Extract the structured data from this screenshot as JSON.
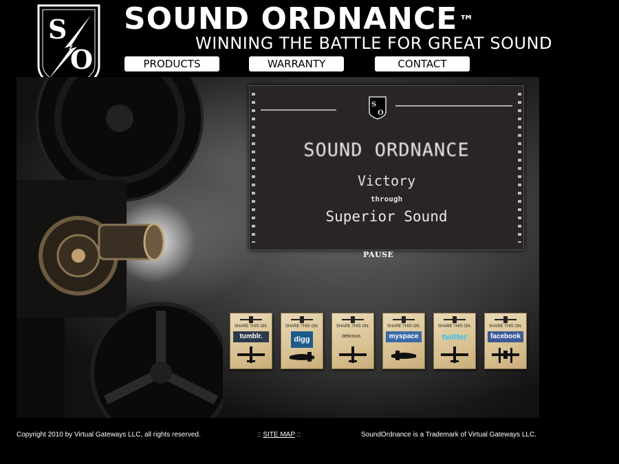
{
  "header": {
    "brand": "SOUND ORDNANCE",
    "trademark": "™",
    "tagline": "WINNING THE BATTLE FOR GREAT SOUND",
    "logo_text": "S/O"
  },
  "nav": [
    {
      "label": "PRODUCTS"
    },
    {
      "label": "WARRANTY"
    },
    {
      "label": "CONTACT"
    }
  ],
  "screen": {
    "title": "SOUND ORDNANCE",
    "line2": "Victory",
    "line3": "through",
    "line4": "Superior Sound",
    "pause_label": "PAUSE"
  },
  "share": {
    "label": "SHARE THIS ON:",
    "services": [
      {
        "name": "tumblr.",
        "color": "#2b3a4a"
      },
      {
        "name": "digg",
        "color": "#1d5a8a"
      },
      {
        "name": "delicious",
        "color": "#ffffff"
      },
      {
        "name": "myspace",
        "color": "#3a6aa8"
      },
      {
        "name": "twitter",
        "color": "#33c1f0"
      },
      {
        "name": "facebook",
        "color": "#3b5998"
      }
    ]
  },
  "footer": {
    "copyright": "Copyright 2010 by Virtual Gateways LLC, all rights reserved.",
    "sitemap_prefix": "::",
    "sitemap_label": "SITE MAP",
    "sitemap_suffix": "::",
    "trademark": "SoundOrdnance is a Trademark of Virtual Gateways LLC."
  },
  "colors": {
    "background": "#000000",
    "screen": "#2a2424",
    "card": "#d9c293"
  }
}
